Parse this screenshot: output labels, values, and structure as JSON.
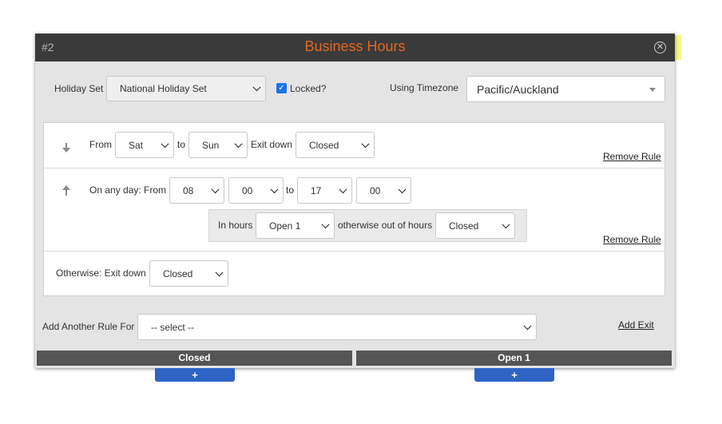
{
  "node": {
    "number": "#2",
    "title": "Business Hours",
    "close_glyph": "✕"
  },
  "header": {
    "holiday_set_label": "Holiday Set",
    "holiday_set_value": "National Holiday Set",
    "locked_label": "Locked?",
    "locked_checked": true,
    "timezone_label": "Using Timezone",
    "timezone_value": "Pacific/Auckland"
  },
  "rules": [
    {
      "from_label": "From",
      "from_value": "Sat",
      "to_label": "to",
      "to_value": "Sun",
      "exit_label": "Exit down",
      "exit_value": "Closed",
      "remove_label": "Remove Rule"
    },
    {
      "prefix_label": "On any day: From",
      "from_hour": "08",
      "from_min": "00",
      "to_label": "to",
      "to_hour": "17",
      "to_min": "00",
      "in_hours_label": "In hours",
      "in_hours_value": "Open 1",
      "otherwise_label": "otherwise out of hours",
      "out_hours_value": "Closed",
      "remove_label": "Remove Rule"
    }
  ],
  "otherwise": {
    "label": "Otherwise: Exit down",
    "value": "Closed"
  },
  "add_rule": {
    "label": "Add Another Rule For",
    "value": "-- select --",
    "add_exit_label": "Add Exit"
  },
  "exits": [
    {
      "label": "Closed"
    },
    {
      "label": "Open 1"
    }
  ],
  "plus_glyph": "+",
  "colors": {
    "title": "#e0661f",
    "titlebar": "#3a3a3a",
    "exit_bar": "#555555",
    "plus_button": "#2d64c6",
    "checkbox": "#1a73e8"
  }
}
